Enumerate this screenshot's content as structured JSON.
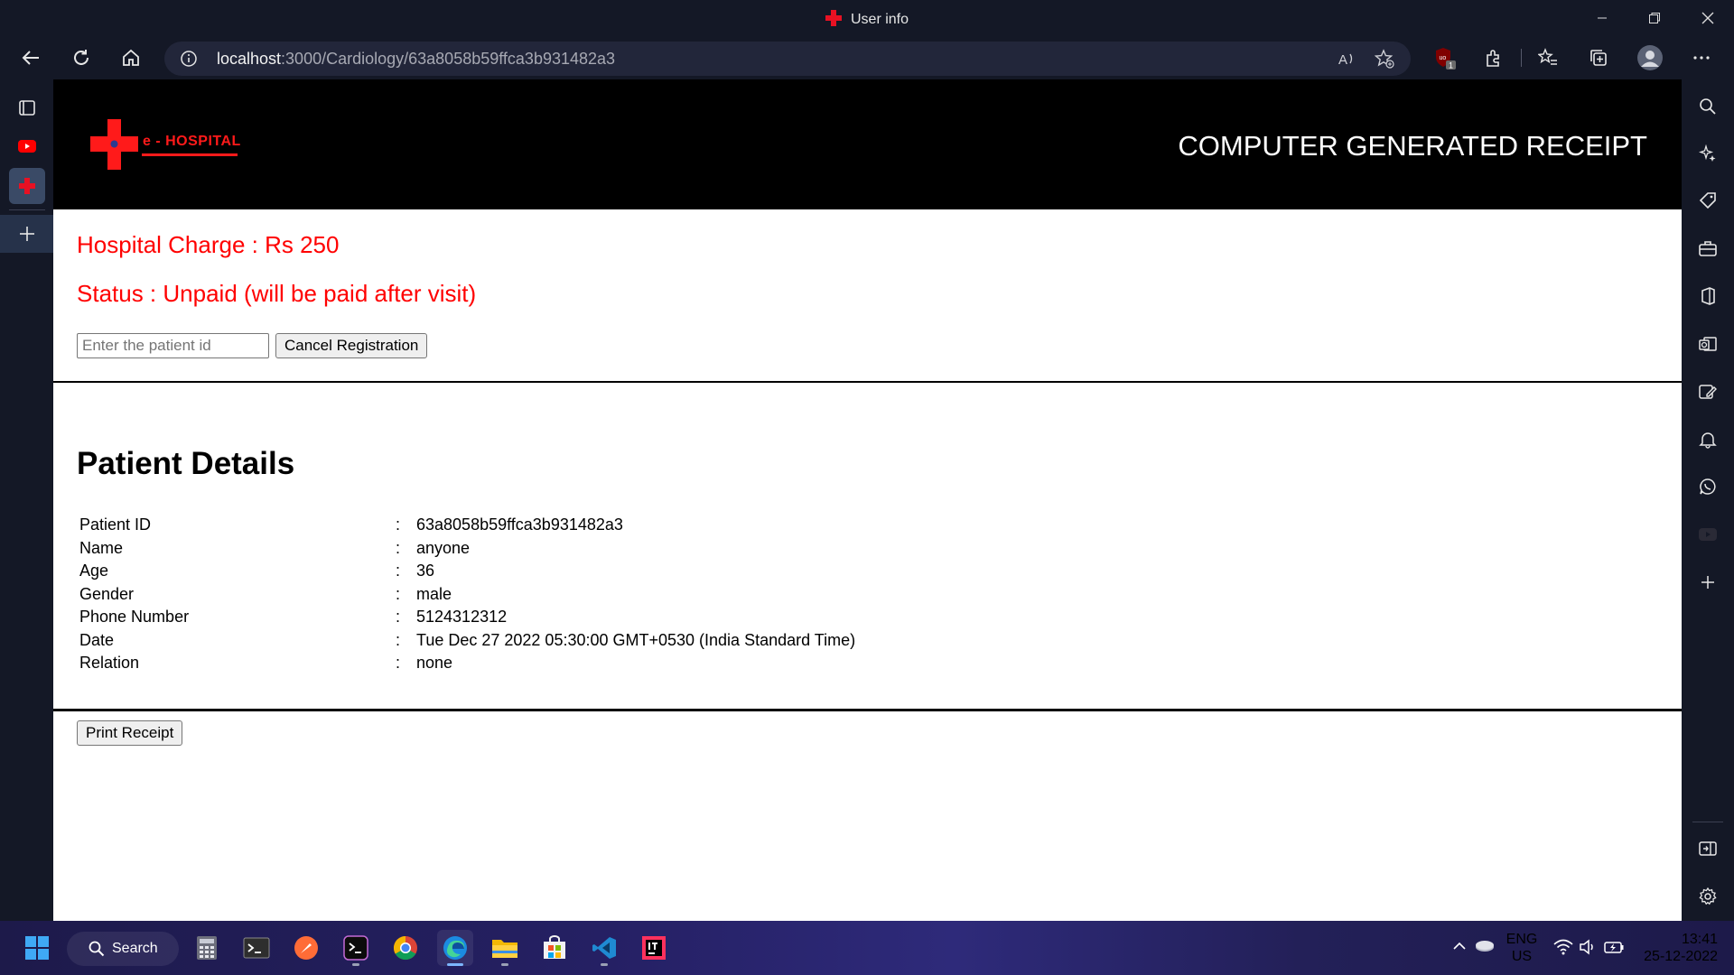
{
  "window": {
    "title": "User info"
  },
  "browser": {
    "url_host": "localhost",
    "url_rest": ":3000/Cardiology/63a8058b59ffca3b931482a3"
  },
  "header": {
    "brand": "e - HOSPITAL",
    "receipt_title": "COMPUTER GENERATED RECEIPT"
  },
  "billing": {
    "charge": "Hospital Charge : Rs 250",
    "status": "Status : Unpaid (will be paid after visit)"
  },
  "cancel_form": {
    "placeholder": "Enter the patient id",
    "button_label": "Cancel Registration"
  },
  "patient": {
    "title": "Patient Details",
    "separator": ":",
    "rows": [
      {
        "label": "Patient ID",
        "value": "63a8058b59ffca3b931482a3"
      },
      {
        "label": "Name",
        "value": "anyone"
      },
      {
        "label": "Age",
        "value": "36"
      },
      {
        "label": "Gender",
        "value": "male"
      },
      {
        "label": "Phone Number",
        "value": "5124312312"
      },
      {
        "label": "Date",
        "value": "Tue Dec 27 2022 05:30:00 GMT+0530 (India Standard Time)"
      },
      {
        "label": "Relation",
        "value": "none"
      }
    ]
  },
  "print_button": "Print Receipt",
  "taskbar": {
    "search": "Search",
    "lang_top": "ENG",
    "lang_bottom": "US",
    "time": "13:41",
    "date": "25-12-2022",
    "badge_count": "1"
  },
  "colors": {
    "accent_red": "#ff1a1a",
    "header_bg": "#000000",
    "browser_chrome": "#141826"
  }
}
